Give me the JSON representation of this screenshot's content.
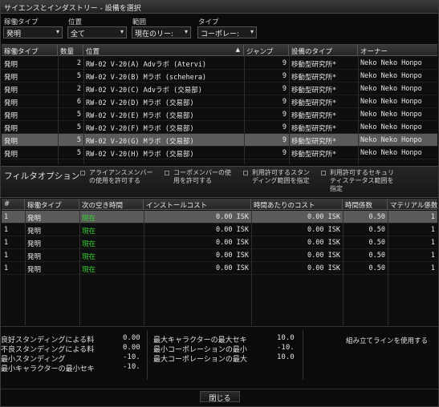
{
  "window": {
    "title": "サイエンスとインダストリー - 設備を選択"
  },
  "filters": {
    "activity_type": {
      "label": "稼働タイプ",
      "value": "発明"
    },
    "location": {
      "label": "位置",
      "value": "全て"
    },
    "range": {
      "label": "範囲",
      "value": "現在のリー:"
    },
    "type": {
      "label": "タイプ",
      "value": "コーポレー:"
    }
  },
  "facilities": {
    "columns": [
      "稼働タイプ",
      "数量",
      "位置",
      "ジャンプ",
      "設備のタイプ",
      "オーナー"
    ],
    "sort_indicator": "▲",
    "rows": [
      {
        "activity": "発明",
        "qty": "2",
        "location": "RW-02 V-20(A) Advラボ (Atervi)",
        "jumps": "9",
        "type": "移動型研究所*",
        "owner": "Neko Neko Honpo"
      },
      {
        "activity": "発明",
        "qty": "5",
        "location": "RW-02 V-20(B) Mラボ (schehera)",
        "jumps": "9",
        "type": "移動型研究所*",
        "owner": "Neko Neko Honpo"
      },
      {
        "activity": "発明",
        "qty": "2",
        "location": "RW-02 V-20(C) Advラボ (交易部)",
        "jumps": "9",
        "type": "移動型研究所*",
        "owner": "Neko Neko Honpo"
      },
      {
        "activity": "発明",
        "qty": "6",
        "location": "RW-02 V-20(D) Mラボ (交易部)",
        "jumps": "9",
        "type": "移動型研究所*",
        "owner": "Neko Neko Honpo"
      },
      {
        "activity": "発明",
        "qty": "5",
        "location": "RW-02 V-20(E) Mラボ (交易部)",
        "jumps": "9",
        "type": "移動型研究所*",
        "owner": "Neko Neko Honpo"
      },
      {
        "activity": "発明",
        "qty": "5",
        "location": "RW-02 V-20(F) Mラボ (交易部)",
        "jumps": "9",
        "type": "移動型研究所*",
        "owner": "Neko Neko Honpo"
      },
      {
        "activity": "発明",
        "qty": "5",
        "location": "RW-02 V-20(G) Mラボ (交易部)",
        "jumps": "9",
        "type": "移動型研究所*",
        "owner": "Neko Neko Honpo"
      },
      {
        "activity": "発明",
        "qty": "5",
        "location": "RW-02 V-20(H) Mラボ (交易部)",
        "jumps": "9",
        "type": "移動型研究所*",
        "owner": "Neko Neko Honpo"
      }
    ],
    "selected_row": 6
  },
  "filter_options": {
    "title": "フィルタオプション",
    "opts": [
      "アライアンスメンバー\nの使用を許可する",
      "コーポメンバーの使\n用を許可する",
      "利用許可するスタン\nディング範囲を指定",
      "利用許可するセキュリ\nティステータス範囲を\n指定"
    ]
  },
  "slots": {
    "columns": [
      "#",
      "稼働タイプ",
      "次の空き時間",
      "インストールコスト",
      "時間あたりのコスト",
      "時間係数",
      "マテリアル係数"
    ],
    "rows": [
      {
        "num": "1",
        "activity": "発明",
        "next": "現在",
        "install": "0.00 ISK",
        "hourly": "0.00 ISK",
        "time": "0.50",
        "mat": "1"
      },
      {
        "num": "1",
        "activity": "発明",
        "next": "現在",
        "install": "0.00 ISK",
        "hourly": "0.00 ISK",
        "time": "0.50",
        "mat": "1"
      },
      {
        "num": "1",
        "activity": "発明",
        "next": "現在",
        "install": "0.00 ISK",
        "hourly": "0.00 ISK",
        "time": "0.50",
        "mat": "1"
      },
      {
        "num": "1",
        "activity": "発明",
        "next": "現在",
        "install": "0.00 ISK",
        "hourly": "0.00 ISK",
        "time": "0.50",
        "mat": "1"
      },
      {
        "num": "1",
        "activity": "発明",
        "next": "現在",
        "install": "0.00 ISK",
        "hourly": "0.00 ISK",
        "time": "0.50",
        "mat": "1"
      }
    ],
    "selected_row": 0
  },
  "standings": {
    "left": [
      {
        "label": "良好スタンディングによる料",
        "value": "0.00"
      },
      {
        "label": "不良スタンディングによる料",
        "value": "0.00"
      },
      {
        "label": "最小スタンディング",
        "value": "-10."
      },
      {
        "label": "最小キャラクターの最小セキ",
        "value": "-10."
      }
    ],
    "right": [
      {
        "label": "最大キャラクターの最大セキ",
        "value": "10.0"
      },
      {
        "label": "最小コーポレーションの最小",
        "value": "-10."
      },
      {
        "label": "最大コーポレーションの最大",
        "value": "10.0"
      }
    ],
    "assembly_line_button": "組み立てラインを使用する"
  },
  "close_button": "閉じる",
  "colors": {
    "accent_green": "#35d035",
    "selected_row": "#5a5a5a"
  }
}
